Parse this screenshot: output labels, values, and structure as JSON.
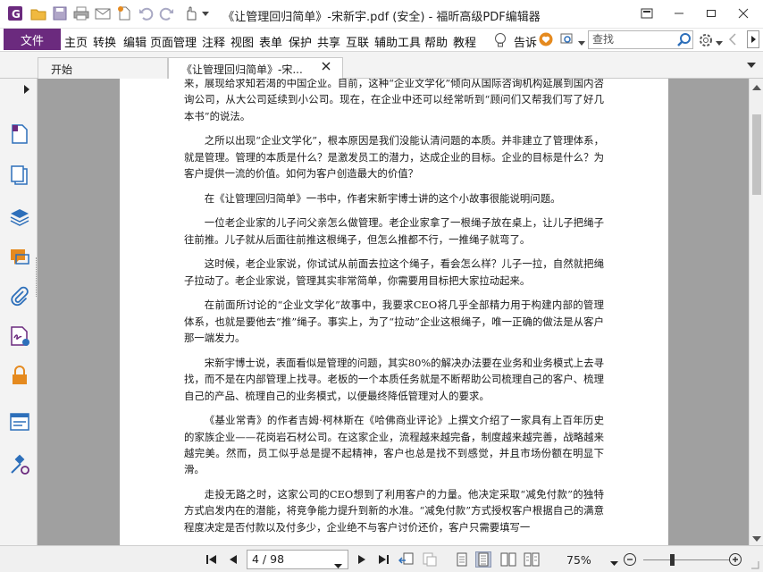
{
  "window": {
    "title": "《让管理回归简单》-宋新宇.pdf (安全) - 福昕高级PDF编辑器"
  },
  "colors": {
    "file_menu_bg": "#6b2a7e",
    "accent_blue": "#2d6fba",
    "accent_orange": "#e58a1f",
    "doc_background": "#a0a0a0"
  },
  "menubar": {
    "file_label": "文件",
    "items": [
      "主页",
      "转换",
      "编辑",
      "页面管理",
      "注释",
      "视图",
      "表单",
      "保护",
      "共享",
      "互联",
      "辅助工具",
      "帮助",
      "教程"
    ],
    "tell_label": "告诉",
    "search_placeholder": "查找"
  },
  "tabs": [
    {
      "label": "开始"
    },
    {
      "label": "《让管理回归简单》-宋..."
    }
  ],
  "left_panel_icons": [
    "pages-icon",
    "copy-pages-icon",
    "layers-icon",
    "comments-icon",
    "attachments-icon",
    "signature-icon",
    "security-icon",
    "form-fields-icon",
    "tools-icon"
  ],
  "document": {
    "paragraphs": [
      {
        "indent": false,
        "text": "来，展现给求知若渴的中国企业。目前，这种“企业文学化”倾向从国际咨询机构延展到国内咨询公司，从大公司延续到小公司。现在，在企业中还可以经常听到“顾问们又帮我们写了好几本书”的说法。"
      },
      {
        "indent": true,
        "text": "之所以出现“企业文学化”，根本原因是我们没能认清问题的本质。并非建立了管理体系，就是管理。管理的本质是什么？是激发员工的潜力，达成企业的目标。企业的目标是什么？为客户提供一流的价值。如何为客户创造最大的价值？"
      },
      {
        "indent": true,
        "text": "在《让管理回归简单》一书中，作者宋新宇博士讲的这个小故事很能说明问题。"
      },
      {
        "indent": true,
        "text": "一位老企业家的儿子问父亲怎么做管理。老企业家拿了一根绳子放在桌上，让儿子把绳子往前推。儿子就从后面往前推这根绳子，但怎么推都不行，一推绳子就弯了。"
      },
      {
        "indent": true,
        "text": "这时候，老企业家说，你试试从前面去拉这个绳子，看会怎么样？儿子一拉，自然就把绳子拉动了。老企业家说，管理其实非常简单，你需要用目标把大家拉动起来。"
      },
      {
        "indent": true,
        "text": "在前面所讨论的“企业文学化”故事中，我要求CEO将几乎全部精力用于构建内部的管理体系，也就是要他去“推”绳子。事实上，为了“拉动”企业这根绳子，唯一正确的做法是从客户那一端发力。"
      },
      {
        "indent": true,
        "text": "宋新宇博士说，表面看似是管理的问题，其实80%的解决办法要在业务和业务模式上去寻找，而不是在内部管理上找寻。老板的一个本质任务就是不断帮助公司梳理自己的客户、梳理自己的产品、梳理自己的业务模式，以便最终降低管理对人的要求。"
      },
      {
        "indent": true,
        "text": "《基业常青》的作者吉姆·柯林斯在《哈佛商业评论》上撰文介绍了一家具有上百年历史的家族企业——花岗岩石材公司。在这家企业，流程越来越完备，制度越来越完善，战略越来越完美。然而，员工似乎总是提不起精神，客户也总是找不到感觉，并且市场份额在明显下滑。"
      },
      {
        "indent": true,
        "text": "走投无路之时，这家公司的CEO想到了利用客户的力量。他决定采取“减免付款”的独特方式启发内在的潜能，将竞争能力提升到新的水准。“减免付款”方式授权客户根据自己的满意程度决定是否付款以及付多少，企业绝不与客户讨价还价，客户只需要填写一"
      }
    ]
  },
  "statusbar": {
    "page_indicator": "4 / 98",
    "zoom": "75%"
  }
}
